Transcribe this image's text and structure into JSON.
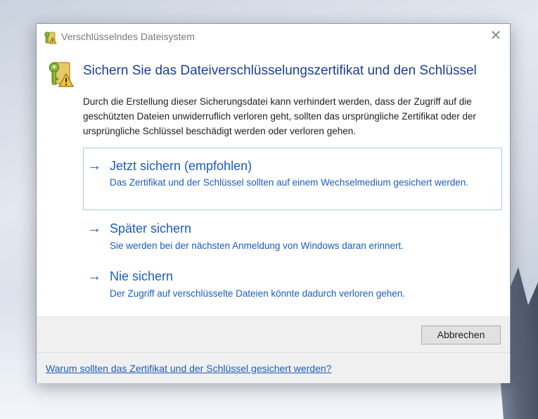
{
  "window": {
    "title": "Verschlüsselndes Dateisystem",
    "icon": "key-warning-icon",
    "close_glyph": "✕"
  },
  "content": {
    "heading": "Sichern Sie das Dateiverschlüsselungszertifikat und den Schlüssel",
    "description": "Durch die Erstellung dieser Sicherungsdatei kann verhindert werden, dass der Zugriff auf die geschützten Dateien unwiderruflich verloren geht, sollten das ursprüngliche Zertifikat oder der ursprüngliche Schlüssel beschädigt werden oder verloren gehen."
  },
  "options": [
    {
      "arrow": "→",
      "title": "Jetzt sichern (empfohlen)",
      "description": "Das Zertifikat und der Schlüssel sollten auf einem Wechselmedium gesichert werden.",
      "selected": true
    },
    {
      "arrow": "→",
      "title": "Später sichern",
      "description": "Sie werden bei der nächsten Anmeldung von Windows daran erinnert.",
      "selected": false
    },
    {
      "arrow": "→",
      "title": "Nie sichern",
      "description": "Der Zugriff auf verschlüsselte Dateien könnte dadurch verloren gehen.",
      "selected": false
    }
  ],
  "buttons": {
    "cancel": "Abbrechen"
  },
  "footer": {
    "help_link": "Warum sollten das Zertifikat und der Schlüssel gesichert werden?"
  },
  "colors": {
    "accent": "#1c5cbe",
    "heading": "#1c3f95",
    "selected_border": "#a8c6e8"
  }
}
